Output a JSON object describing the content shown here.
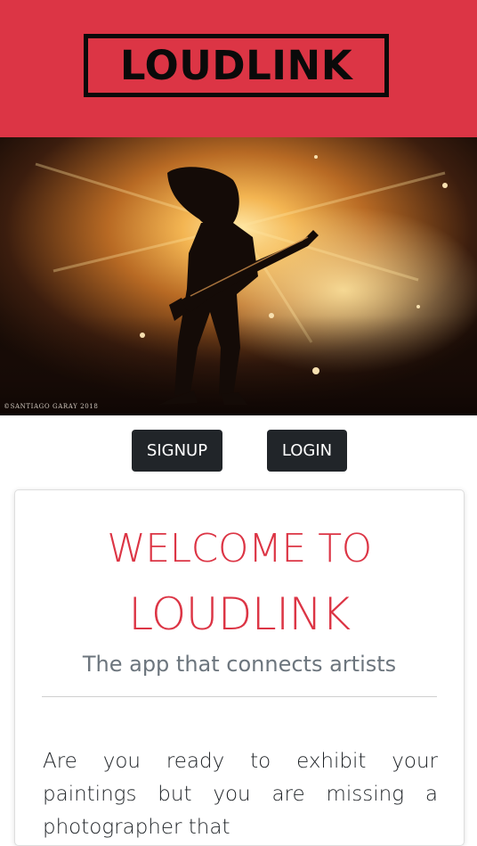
{
  "header": {
    "logo": "LOUDLINK",
    "bg_color": "#dc3545"
  },
  "hero": {
    "description": "concert-guitarist-photo",
    "credit": "©SANTIAGO GARAY 2018"
  },
  "actions": {
    "signup_label": "SIGNUP",
    "login_label": "LOGIN"
  },
  "card": {
    "heading_line1": "WELCOME TO",
    "heading_line2": "LOUDLINK",
    "subtitle": "The app that connects artists",
    "body": "Are you ready to exhibit your paintings but you are missing a photographer that"
  },
  "colors": {
    "accent": "#dc3545",
    "button": "#212529",
    "muted": "#6c757d"
  }
}
